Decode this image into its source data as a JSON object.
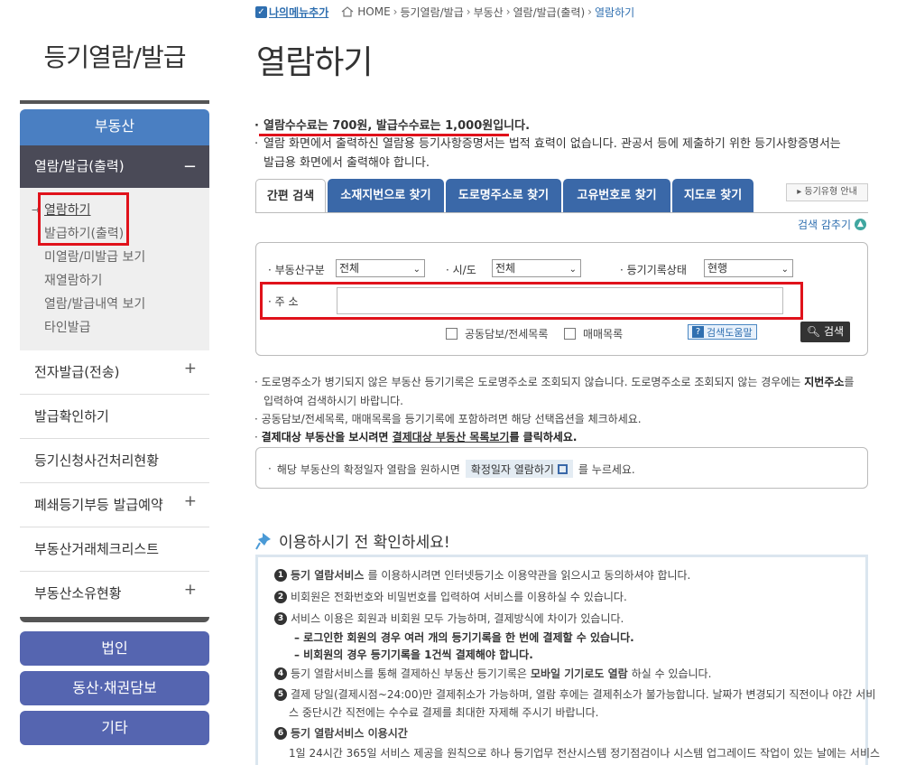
{
  "sidebar": {
    "title": "등기열람/발급",
    "category_active": "부동산",
    "open_menu": "열람/발급(출력)",
    "submenu": [
      "열람하기",
      "발급하기(출력)",
      "미열람/미발급 보기",
      "재열람하기",
      "열람/발급내역 보기",
      "타인발급"
    ],
    "items": [
      "전자발급(전송)",
      "발급확인하기",
      "등기신청사건처리현황",
      "폐쇄등기부등 발급예약",
      "부동산거래체크리스트",
      "부동산소유현황"
    ],
    "categories": [
      "법인",
      "동산·채권담보",
      "기타"
    ]
  },
  "breadcrumb": {
    "mymenu": "나의메뉴추가",
    "items": [
      "HOME",
      "등기열람/발급",
      "부동산",
      "열람/발급(출력)"
    ],
    "current": "열람하기"
  },
  "page_title": "열람하기",
  "notices": {
    "fee": "열람수수료는 700원, 발급수수료는 1,000원입니다.",
    "line2": "열람 화면에서 출력하신 열람용 등기사항증명서는 법적 효력이 없습니다. 관공서 등에 제출하기 위한 등기사항증명서는",
    "line3": "발급용 화면에서 출력해야 합니다."
  },
  "tabs": [
    "간편 검색",
    "소재지번으로 찾기",
    "도로명주소로 찾기",
    "고유번호로 찾기",
    "지도로 찾기"
  ],
  "guide_button": "등기유형 안내",
  "collapse_label": "검색 감추기",
  "search": {
    "type_label": "부동산구분",
    "type_value": "전체",
    "city_label": "시/도",
    "city_value": "전체",
    "status_label": "등기기록상태",
    "status_value": "현행",
    "address_label": "주 소",
    "option1": "공동담보/전세목록",
    "option2": "매매목록",
    "help": "검색도움말",
    "search_button": "검색"
  },
  "info": {
    "l1": "도로명주소가 병기되지 않은 부동산 등기기록은 도로명주소로 조회되지 않습니다. 도로명주소로 조회되지 않는 경우에는 ",
    "l1b": "지번주소",
    "l1c": "를",
    "l2": "입력하여 검색하시기 바랍니다.",
    "l3": "공동담보/전세목록, 매매목록을 등기기록에 포함하려면 해당 선택옵션을 체크하세요.",
    "l4a": "결제대상 부동산을 보시려면 ",
    "l4b": "결제대상 부동산 목록보기",
    "l4c": "를 클릭하세요."
  },
  "fix": {
    "pre": "해당 부동산의 확정일자 열람을 원하시면",
    "button": "확정일자 열람하기",
    "post": "를 누르세요."
  },
  "check": {
    "title": "이용하시기 전 확인하세요!",
    "i1a": "등기 열람서비스",
    "i1b": "를 이용하시려면 인터넷등기소 이용약관을 읽으시고 동의하셔야 합니다.",
    "i2": "비회원은 전화번호와 비밀번호를 입력하여 서비스를 이용하실 수 있습니다.",
    "i3": "서비스 이용은 회원과 비회원 모두 가능하며, 결제방식에 차이가 있습니다.",
    "s1": "– 로그인한 회원의 경우 여러 개의 등기기록을 한 번에 결제할 수 있습니다.",
    "s2": "– 비회원의 경우 등기기록을 1건씩 결제해야 합니다.",
    "i4a": "등기 열람서비스를 통해 결제하신 부동산 등기기록은 ",
    "i4b": "모바일 기기로도 열람",
    "i4c": "하실 수 있습니다.",
    "i5": "결제 당일(결제시점~24:00)만 결제취소가 가능하며, 열람 후에는 결제취소가 불가능합니다. 날짜가 변경되기 직전이나 야간 서비",
    "i5b": "스 중단시간 직전에는 수수료 결제를 최대한 자제해 주시기 바랍니다.",
    "i6": "등기 열람서비스 이용시간",
    "i6b": "1일 24시간 365일 서비스 제공을 원칙으로 하나 등기업무 전산시스템 정기점검이나 시스템 업그레이드 작업이 있는 날에는 서비스"
  }
}
